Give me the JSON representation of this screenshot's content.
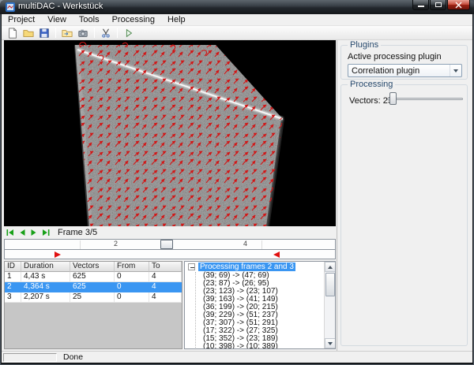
{
  "window": {
    "title": "multiDAC - Werkstück"
  },
  "menu": {
    "items": [
      "Project",
      "View",
      "Tools",
      "Processing",
      "Help"
    ]
  },
  "toolbar": {
    "icons": [
      "new-document",
      "open-folder",
      "save",
      "import-folder",
      "camera",
      "cut",
      "run"
    ]
  },
  "right_panel": {
    "plugins": {
      "title": "Plugins",
      "active_label": "Active processing plugin",
      "selected_plugin": "Correlation plugin"
    },
    "processing": {
      "title": "Processing",
      "vectors_label": "Vectors: 25"
    }
  },
  "playback": {
    "icons": [
      "first-frame",
      "previous-frame",
      "next-frame",
      "last-frame"
    ],
    "frame_label": "Frame 3/5",
    "ticks": [
      "2",
      "4"
    ]
  },
  "jobs_table": {
    "columns": [
      "ID",
      "Duration",
      "Vectors",
      "From",
      "To"
    ],
    "rows": [
      [
        "1",
        "4,43 s",
        "625",
        "0",
        "4"
      ],
      [
        "2",
        "4,364 s",
        "625",
        "0",
        "4"
      ],
      [
        "3",
        "2,207 s",
        "25",
        "0",
        "4"
      ]
    ],
    "selected_row_index": 1
  },
  "vector_tree": {
    "root_label": "Processing frames 2 and 3",
    "items": [
      "(39; 69) -> (47; 69)",
      "(23; 87) -> (26; 95)",
      "(23; 123) -> (23; 107)",
      "(39; 163) -> (41; 149)",
      "(36; 199) -> (20; 215)",
      "(39; 229) -> (51; 237)",
      "(37; 307) -> (51; 291)",
      "(17; 322) -> (27; 325)",
      "(15; 352) -> (23; 189)",
      "(10; 398) -> (10; 389)"
    ]
  },
  "statusbar": {
    "text": "Done"
  }
}
